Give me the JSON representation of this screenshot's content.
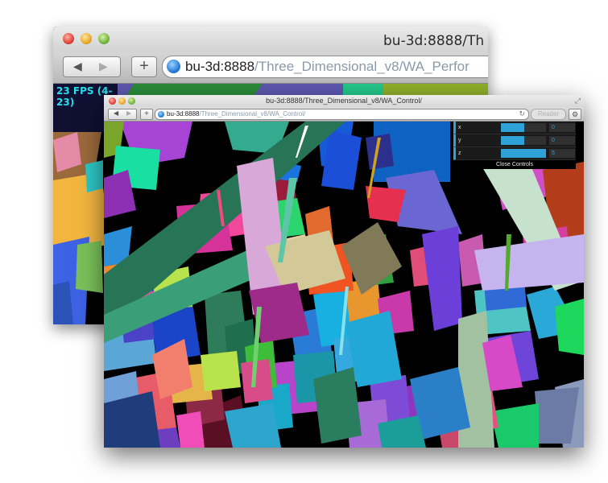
{
  "back_window": {
    "title": "bu-3d:8888/Th",
    "url_host": "bu-3d:8888",
    "url_path": "/Three_Dimensional_v8/WA_Perfor",
    "fps_text": "23 FPS (4-23)"
  },
  "front_window": {
    "title": "bu-3d:8888/Three_Dimensional_v8/WA_Control/",
    "url_host": "bu-3d:8888",
    "url_path": "/Three_Dimensional_v8/WA_Control/",
    "reader_label": "Reader"
  },
  "controls": {
    "rows": [
      {
        "label": "x",
        "value": "0",
        "fill": 0.52
      },
      {
        "label": "y",
        "value": "0",
        "fill": 0.52
      },
      {
        "label": "z",
        "value": "5",
        "fill": 1.0
      }
    ],
    "close_label": "Close Controls"
  },
  "icons": {
    "back": "back-arrow-icon",
    "forward": "forward-arrow-icon",
    "add_bookmark": "plus-icon",
    "site": "globe-icon",
    "reload": "reload-icon",
    "settings": "gear-icon",
    "fullscreen": "resize-arrows-icon"
  }
}
